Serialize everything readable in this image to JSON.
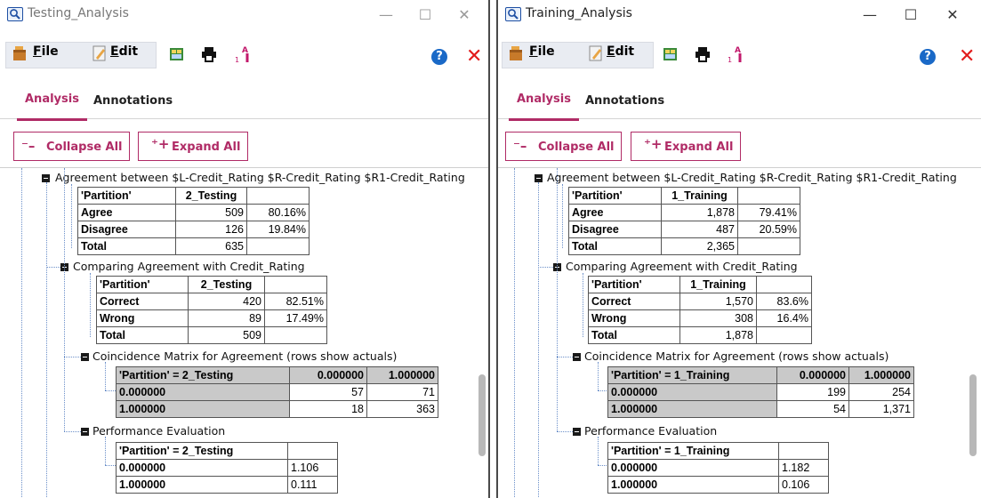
{
  "left": {
    "title": "Testing_Analysis",
    "toolbar": {
      "file": "File",
      "file_u": "F",
      "file_rest": "ile",
      "edit": "Edit",
      "edit_u": "E",
      "edit_rest": "dit"
    },
    "tabs": {
      "analysis": "Analysis",
      "annotations": "Annotations"
    },
    "buttons": {
      "collapse": "Collapse All",
      "expand": "Expand All"
    },
    "agreement": {
      "heading": "Agreement between  $L-Credit_Rating $R-Credit_Rating $R1-Credit_Rating",
      "header": [
        "'Partition'",
        "2_Testing",
        ""
      ],
      "rows": [
        [
          "Agree",
          "509",
          "80.16%"
        ],
        [
          "Disagree",
          "126",
          "19.84%"
        ],
        [
          "Total",
          "635",
          ""
        ]
      ]
    },
    "comparing": {
      "heading": "Comparing Agreement with Credit_Rating",
      "header": [
        "'Partition'",
        "2_Testing",
        ""
      ],
      "rows": [
        [
          "Correct",
          "420",
          "82.51%"
        ],
        [
          "Wrong",
          "89",
          "17.49%"
        ],
        [
          "Total",
          "509",
          ""
        ]
      ]
    },
    "coincidence": {
      "heading": "Coincidence Matrix for Agreement (rows show actuals)",
      "header": [
        "'Partition' = 2_Testing",
        "0.000000",
        "1.000000"
      ],
      "rows": [
        [
          "0.000000",
          "57",
          "71"
        ],
        [
          "1.000000",
          "18",
          "363"
        ]
      ]
    },
    "performance": {
      "heading": "Performance Evaluation",
      "header": [
        "'Partition' = 2_Testing",
        ""
      ],
      "rows": [
        [
          "0.000000",
          "1.106"
        ],
        [
          "1.000000",
          "0.111"
        ]
      ]
    }
  },
  "right": {
    "title": "Training_Analysis",
    "toolbar": {
      "file": "File",
      "file_u": "F",
      "file_rest": "ile",
      "edit": "Edit",
      "edit_u": "E",
      "edit_rest": "dit"
    },
    "tabs": {
      "analysis": "Analysis",
      "annotations": "Annotations"
    },
    "buttons": {
      "collapse": "Collapse All",
      "expand": "Expand All"
    },
    "agreement": {
      "heading": "Agreement between  $L-Credit_Rating $R-Credit_Rating $R1-Credit_Rating",
      "header": [
        "'Partition'",
        "1_Training",
        ""
      ],
      "rows": [
        [
          "Agree",
          "1,878",
          "79.41%"
        ],
        [
          "Disagree",
          "487",
          "20.59%"
        ],
        [
          "Total",
          "2,365",
          ""
        ]
      ]
    },
    "comparing": {
      "heading": "Comparing Agreement with Credit_Rating",
      "header": [
        "'Partition'",
        "1_Training",
        ""
      ],
      "rows": [
        [
          "Correct",
          "1,570",
          "83.6%"
        ],
        [
          "Wrong",
          "308",
          "16.4%"
        ],
        [
          "Total",
          "1,878",
          ""
        ]
      ]
    },
    "coincidence": {
      "heading": "Coincidence Matrix for Agreement (rows show actuals)",
      "header": [
        "'Partition' = 1_Training",
        "0.000000",
        "1.000000"
      ],
      "rows": [
        [
          "0.000000",
          "199",
          "254"
        ],
        [
          "1.000000",
          "54",
          "1,371"
        ]
      ]
    },
    "performance": {
      "heading": "Performance Evaluation",
      "header": [
        "'Partition' = 1_Training",
        ""
      ],
      "rows": [
        [
          "0.000000",
          "1.182"
        ],
        [
          "1.000000",
          "0.106"
        ]
      ]
    }
  },
  "icons": [
    "search-window-icon",
    "file-icon",
    "edit-icon",
    "export-icon",
    "print-icon",
    "sort-icon",
    "help-icon",
    "close-icon"
  ],
  "colors": {
    "accent": "#b02b66",
    "close_red": "#e21b1b",
    "help_blue": "#1a69c7",
    "grey_cell": "#c9c9c9"
  }
}
